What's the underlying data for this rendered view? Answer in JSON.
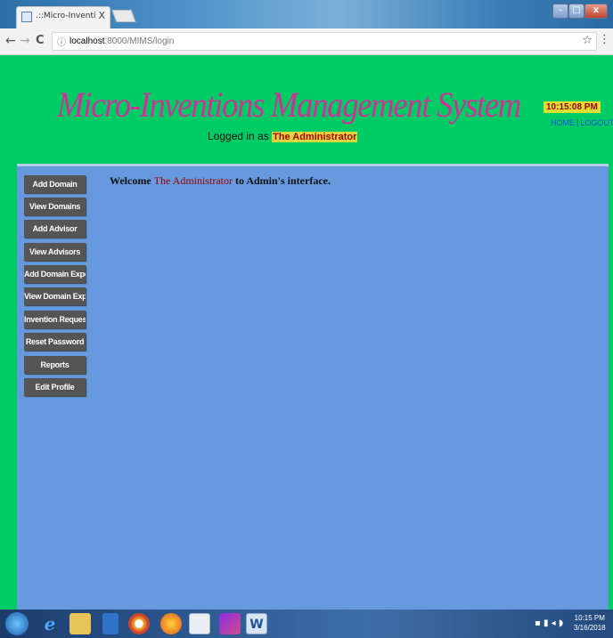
{
  "browser": {
    "tab_title": ".::Micro-Inventions Manage",
    "tab_close": "X",
    "url_host": "localhost",
    "url_path": ":8000/MIMS/login",
    "info_glyph": "ⓘ",
    "back_glyph": "←",
    "forward_glyph": "→",
    "reload_glyph": "C",
    "star_glyph": "☆",
    "menu_glyph": "⋮",
    "minimize_glyph": "–",
    "maximize_glyph": "□",
    "close_glyph": "x"
  },
  "header": {
    "title": "Micro-Inventions Management System",
    "logged_in_prefix": "Logged in as",
    "user": "The Administrator",
    "clock": "10:15:08 PM",
    "home_link": "HOME",
    "separator": "|",
    "logout_link": "LOGOUT"
  },
  "sidebar": {
    "items": [
      {
        "label": "Add Domain"
      },
      {
        "label": "View Domains"
      },
      {
        "label": "Add Advisor"
      },
      {
        "label": "View Advisors"
      },
      {
        "label": "Add Domain Expert"
      },
      {
        "label": "View Domain Experts"
      },
      {
        "label": "Invention Requests"
      },
      {
        "label": "Reset Password"
      },
      {
        "label": "Reports"
      },
      {
        "label": "Edit Profile"
      }
    ]
  },
  "main": {
    "welcome_prefix": "Welcome",
    "welcome_user": "The Administrator",
    "welcome_suffix": "to Admin's interface."
  },
  "taskbar": {
    "clock_time": "10:15 PM",
    "clock_date": "3/16/2018"
  },
  "colors": {
    "page_bg": "#00cc66",
    "content_bg": "#6699dd",
    "title": "#cc3399",
    "sidebar_button": "#555555",
    "highlight": "#dede33",
    "user_text": "#990000"
  }
}
